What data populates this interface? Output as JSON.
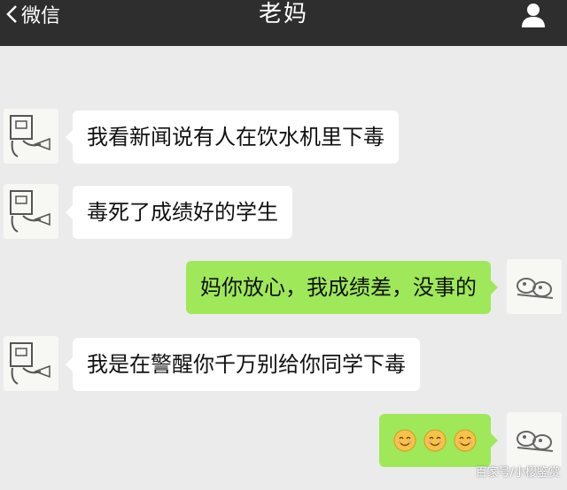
{
  "header": {
    "back_label": "微信",
    "title": "老妈"
  },
  "messages": [
    {
      "side": "in",
      "text": "我看新闻说有人在饮水机里下毒"
    },
    {
      "side": "in",
      "text": "毒死了成绩好的学生"
    },
    {
      "side": "out",
      "text": "妈你放心，我成绩差，没事的"
    },
    {
      "side": "in",
      "text": "我是在警醒你千万别给你同学下毒"
    },
    {
      "side": "out",
      "emoji": [
        "smile-emoji",
        "smile-emoji",
        "smile-emoji"
      ]
    }
  ],
  "watermark": "百家号/小樱鉴赏",
  "colors": {
    "header_bg": "#2e2e2e",
    "chat_bg": "#ebebeb",
    "incoming_bubble": "#ffffff",
    "outgoing_bubble": "#9ee85a"
  }
}
